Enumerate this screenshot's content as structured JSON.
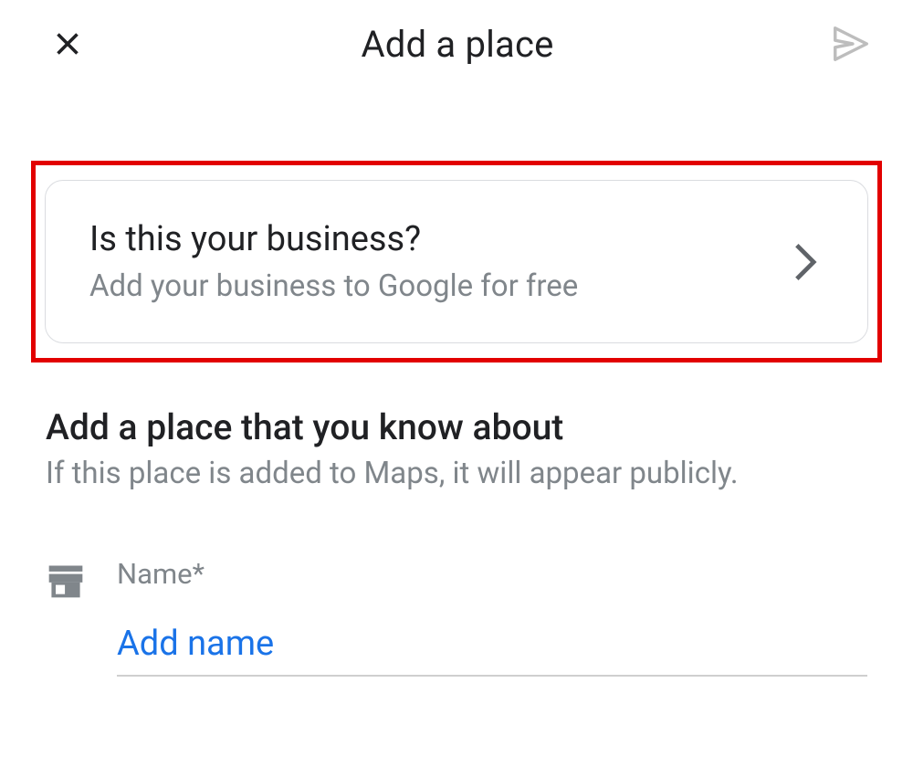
{
  "header": {
    "title": "Add a place"
  },
  "business_card": {
    "title": "Is this your business?",
    "subtitle": "Add your business to Google for free"
  },
  "section": {
    "title": "Add a place that you know about",
    "subtitle": "If this place is added to Maps, it will appear publicly."
  },
  "form": {
    "name": {
      "label": "Name*",
      "placeholder": "Add name",
      "value": ""
    }
  }
}
